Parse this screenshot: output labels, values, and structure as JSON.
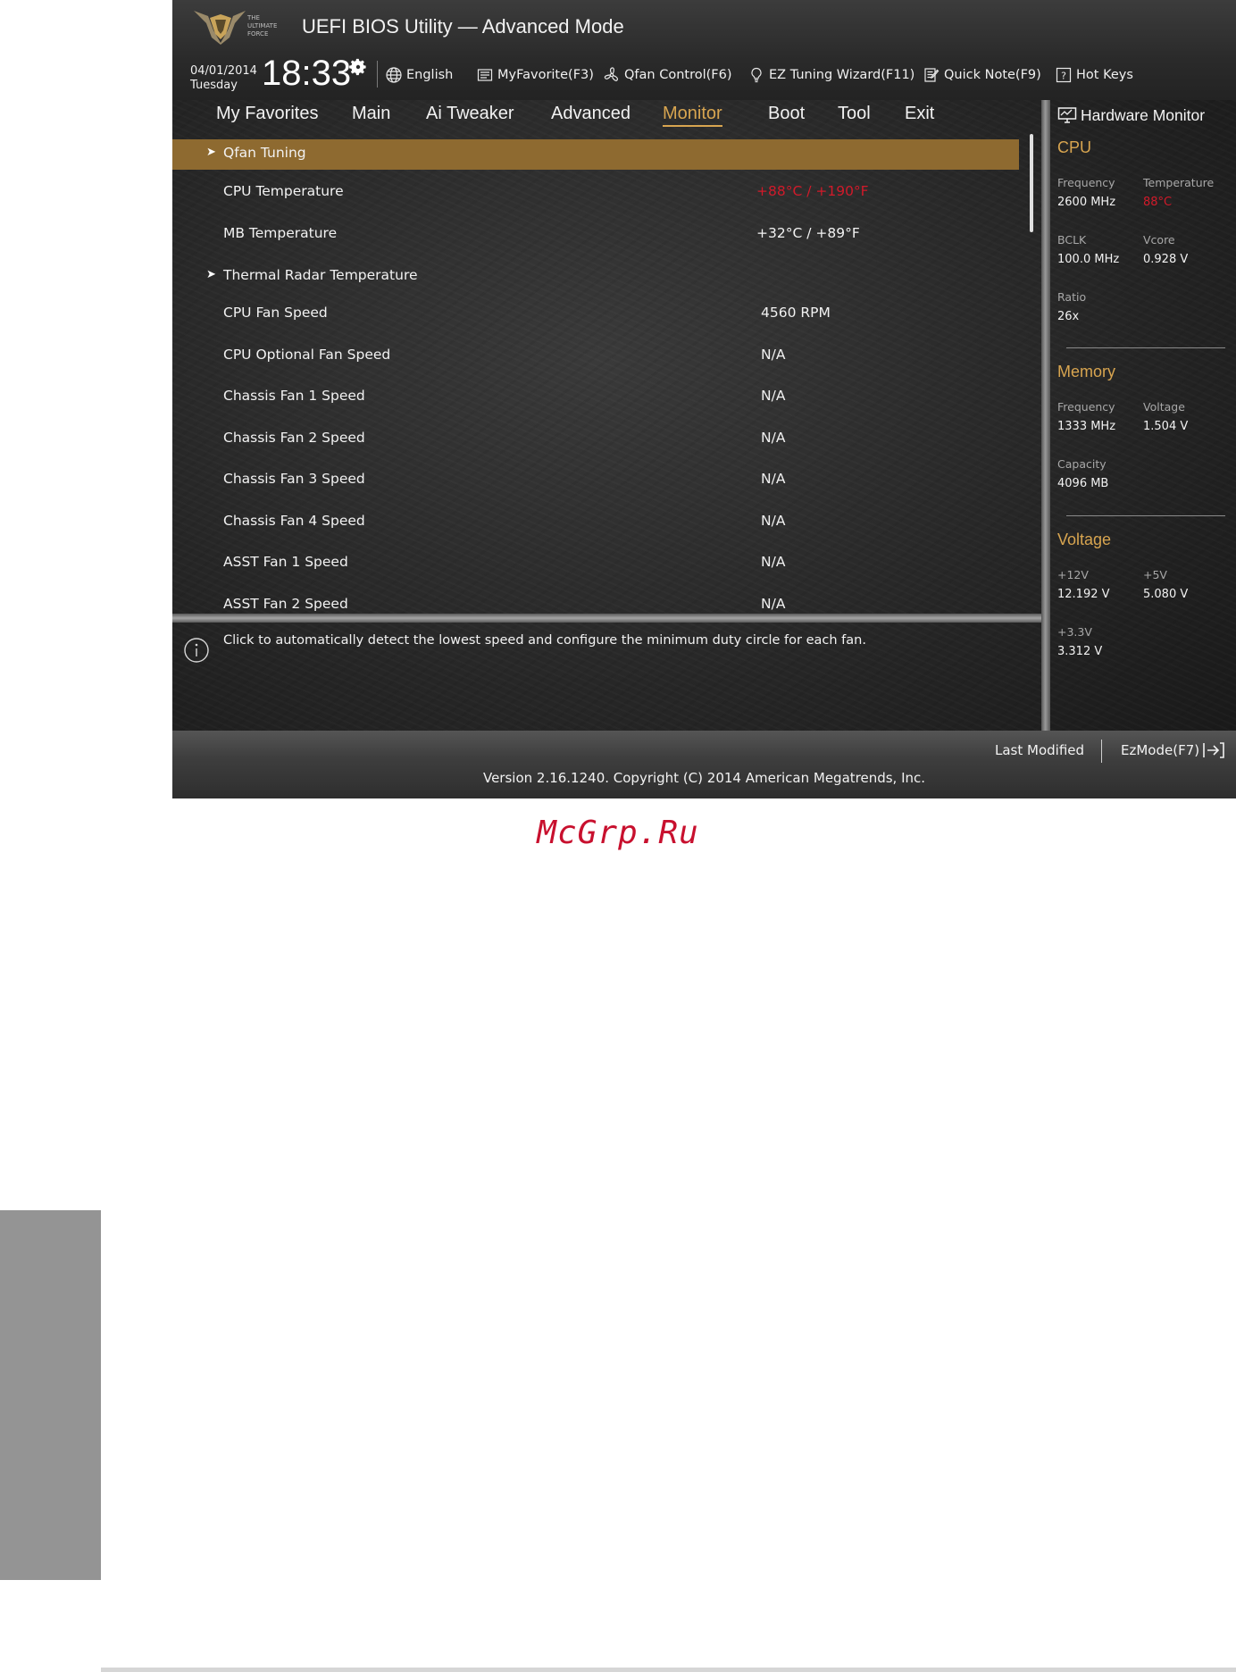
{
  "header": {
    "title": "UEFI BIOS Utility — Advanced Mode",
    "logo_text": [
      "THE",
      "ULTIMATE",
      "FORCE"
    ],
    "date": "04/01/2014",
    "day": "Tuesday",
    "time": "18:33",
    "tools": [
      {
        "label": "English",
        "icon": "globe-icon"
      },
      {
        "label": "MyFavorite(F3)",
        "icon": "favorite-list-icon"
      },
      {
        "label": "Qfan Control(F6)",
        "icon": "fan-icon"
      },
      {
        "label": "EZ Tuning Wizard(F11)",
        "icon": "lightbulb-icon"
      },
      {
        "label": "Quick Note(F9)",
        "icon": "note-icon"
      },
      {
        "label": "Hot Keys",
        "icon": "help-key-icon"
      }
    ]
  },
  "nav": {
    "tabs": [
      "My Favorites",
      "Main",
      "Ai Tweaker",
      "Advanced",
      "Monitor",
      "Boot",
      "Tool",
      "Exit"
    ],
    "active": "Monitor"
  },
  "main": {
    "rows": [
      {
        "label": "Qfan Tuning",
        "value": "",
        "submenu": true,
        "selected": true
      },
      {
        "label": "CPU Temperature",
        "value": "+88°C / +190°F",
        "hot": true
      },
      {
        "label": "MB Temperature",
        "value": "+32°C / +89°F"
      },
      {
        "label": "Thermal Radar Temperature",
        "value": "",
        "submenu": true
      },
      {
        "label": "CPU Fan Speed",
        "value": "4560 RPM"
      },
      {
        "label": "CPU Optional Fan Speed",
        "value": "N/A"
      },
      {
        "label": "Chassis Fan 1 Speed",
        "value": "N/A"
      },
      {
        "label": "Chassis Fan 2 Speed",
        "value": "N/A"
      },
      {
        "label": "Chassis Fan 3 Speed",
        "value": "N/A"
      },
      {
        "label": "Chassis Fan 4 Speed",
        "value": "N/A"
      },
      {
        "label": "ASST Fan 1 Speed",
        "value": "N/A"
      },
      {
        "label": "ASST Fan 2 Speed",
        "value": "N/A"
      }
    ],
    "help_text": "Click to automatically detect the lowest speed and configure the minimum duty circle for each fan."
  },
  "hw_monitor": {
    "title": "Hardware Monitor",
    "cpu": {
      "title": "CPU",
      "frequency_label": "Frequency",
      "frequency": "2600 MHz",
      "temperature_label": "Temperature",
      "temperature": "88°C",
      "bclk_label": "BCLK",
      "bclk": "100.0 MHz",
      "vcore_label": "Vcore",
      "vcore": "0.928 V",
      "ratio_label": "Ratio",
      "ratio": "26x"
    },
    "memory": {
      "title": "Memory",
      "frequency_label": "Frequency",
      "frequency": "1333 MHz",
      "voltage_label": "Voltage",
      "voltage": "1.504 V",
      "capacity_label": "Capacity",
      "capacity": "4096 MB"
    },
    "voltage": {
      "title": "Voltage",
      "v12_label": "+12V",
      "v12": "12.192 V",
      "v5_label": "+5V",
      "v5": "5.080 V",
      "v33_label": "+3.3V",
      "v33": "3.312 V"
    }
  },
  "footer": {
    "last_modified": "Last Modified",
    "ezmode": "EzMode(F7)",
    "version": "Version 2.16.1240. Copyright (C) 2014 American Megatrends, Inc."
  },
  "page": {
    "watermark": "McGrp.Ru"
  },
  "colors": {
    "accent": "#d8a550",
    "selected_row": "#8e6a30",
    "alert": "#d11a2a",
    "watermark": "#c8102e"
  }
}
